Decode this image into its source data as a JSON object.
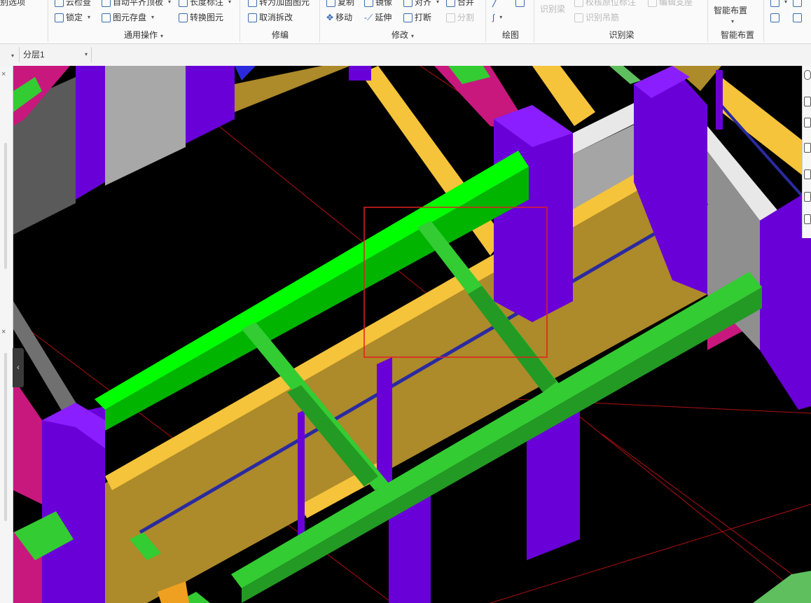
{
  "ribbon": {
    "row1": {
      "selection": "别选项",
      "cloud_check": "云检查",
      "auto_level_slab": "自动平齐顶板",
      "length_mark": "长度标注",
      "to_reinforce": "转为加固图元",
      "copy": "复制",
      "mirror": "镜像",
      "align": "对齐",
      "merge": "合并",
      "recognize_beam": "识别梁",
      "verify_origin_mark": "校核原位标注",
      "edit_support": "编辑支座",
      "smart_layout": "智能布置"
    },
    "row2": {
      "lock": "锁定",
      "element_save": "图元存盘",
      "convert_element": "转换图元",
      "cancel_split": "取消拆改",
      "move": "移动",
      "extend": "延伸",
      "break": "打断",
      "split": "分割",
      "recognize_hanger": "识别吊筋"
    },
    "groups": {
      "common_ops": "通用操作",
      "edit": "修编",
      "modify": "修改",
      "draw": "绘图",
      "recognize_beam": "识别梁",
      "smart_layout": "智能布置"
    },
    "caret": "▾"
  },
  "toolbar": {
    "layer": "分层1",
    "caret": "▾"
  },
  "left_panel": {
    "close": "×",
    "collapse": "‹"
  },
  "colors": {
    "background": "#000000",
    "green_beam": "#00e600",
    "secondary_beam": "#2dc52d",
    "column": "#6a00d8",
    "wall_top": "#f5c43a",
    "wall_face": "#ad8a2a",
    "magenta_slab": "#c8187e",
    "selection_box": "#e02020"
  },
  "icons": [
    "search-icon",
    "lock-icon",
    "save-icon",
    "convert-icon",
    "move-icon",
    "extend-icon",
    "break-icon",
    "split-icon",
    "mirror-icon",
    "align-icon",
    "merge-icon",
    "draw-line-icon",
    "draw-arc-icon"
  ]
}
